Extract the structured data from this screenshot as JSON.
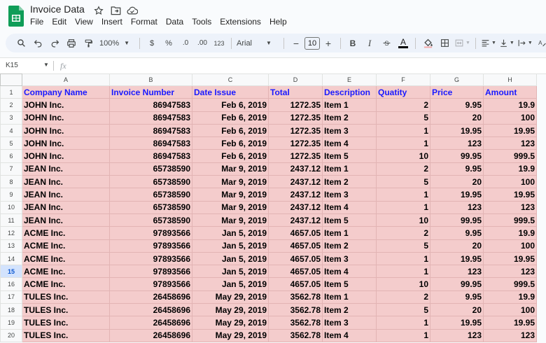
{
  "app": {
    "title": "Invoice Data",
    "menu": [
      "File",
      "Edit",
      "View",
      "Insert",
      "Format",
      "Data",
      "Tools",
      "Extensions",
      "Help"
    ],
    "icons": [
      "star-icon",
      "move-folder-icon",
      "cloud-status-icon"
    ]
  },
  "toolbar": {
    "zoom": "100%",
    "currency": "$",
    "percent": "%",
    "decrease_decimal": ".0",
    "increase_decimal": ".00",
    "number_format": "123",
    "font": "Arial",
    "font_size": "10",
    "bold": "B",
    "italic": "I",
    "text_color_label": "A",
    "text_color": "#000000",
    "fill_color": "#f4cccc"
  },
  "formula_bar": {
    "cell_ref": "K15",
    "fx": "fx",
    "value": ""
  },
  "sheet": {
    "columns": [
      "A",
      "B",
      "C",
      "D",
      "E",
      "F",
      "G",
      "H"
    ],
    "active_row": 15,
    "header": [
      "Company Name",
      "Invoice Number",
      "Date Issue",
      "Total",
      "Description",
      "Quatity",
      "Price",
      "Amount"
    ],
    "rows": [
      [
        "JOHN Inc.",
        "86947583",
        "Feb 6, 2019",
        "1272.35",
        "Item 1",
        "2",
        "9.95",
        "19.9"
      ],
      [
        "JOHN Inc.",
        "86947583",
        "Feb 6, 2019",
        "1272.35",
        "Item 2",
        "5",
        "20",
        "100"
      ],
      [
        "JOHN Inc.",
        "86947583",
        "Feb 6, 2019",
        "1272.35",
        "Item 3",
        "1",
        "19.95",
        "19.95"
      ],
      [
        "JOHN Inc.",
        "86947583",
        "Feb 6, 2019",
        "1272.35",
        "Item 4",
        "1",
        "123",
        "123"
      ],
      [
        "JOHN Inc.",
        "86947583",
        "Feb 6, 2019",
        "1272.35",
        "Item 5",
        "10",
        "99.95",
        "999.5"
      ],
      [
        "JEAN Inc.",
        "65738590",
        "Mar 9, 2019",
        "2437.12",
        "Item 1",
        "2",
        "9.95",
        "19.9"
      ],
      [
        "JEAN Inc.",
        "65738590",
        "Mar 9, 2019",
        "2437.12",
        "Item 2",
        "5",
        "20",
        "100"
      ],
      [
        "JEAN Inc.",
        "65738590",
        "Mar 9, 2019",
        "2437.12",
        "Item 3",
        "1",
        "19.95",
        "19.95"
      ],
      [
        "JEAN Inc.",
        "65738590",
        "Mar 9, 2019",
        "2437.12",
        "Item 4",
        "1",
        "123",
        "123"
      ],
      [
        "JEAN Inc.",
        "65738590",
        "Mar 9, 2019",
        "2437.12",
        "Item 5",
        "10",
        "99.95",
        "999.5"
      ],
      [
        "ACME Inc.",
        "97893566",
        "Jan 5, 2019",
        "4657.05",
        "Item 1",
        "2",
        "9.95",
        "19.9"
      ],
      [
        "ACME Inc.",
        "97893566",
        "Jan 5, 2019",
        "4657.05",
        "Item 2",
        "5",
        "20",
        "100"
      ],
      [
        "ACME Inc.",
        "97893566",
        "Jan 5, 2019",
        "4657.05",
        "Item 3",
        "1",
        "19.95",
        "19.95"
      ],
      [
        "ACME Inc.",
        "97893566",
        "Jan 5, 2019",
        "4657.05",
        "Item 4",
        "1",
        "123",
        "123"
      ],
      [
        "ACME Inc.",
        "97893566",
        "Jan 5, 2019",
        "4657.05",
        "Item 5",
        "10",
        "99.95",
        "999.5"
      ],
      [
        "TULES Inc.",
        "26458696",
        "May 29, 2019",
        "3562.78",
        "Item 1",
        "2",
        "9.95",
        "19.9"
      ],
      [
        "TULES Inc.",
        "26458696",
        "May 29, 2019",
        "3562.78",
        "Item 2",
        "5",
        "20",
        "100"
      ],
      [
        "TULES Inc.",
        "26458696",
        "May 29, 2019",
        "3562.78",
        "Item 3",
        "1",
        "19.95",
        "19.95"
      ],
      [
        "TULES Inc.",
        "26458696",
        "May 29, 2019",
        "3562.78",
        "Item 4",
        "1",
        "123",
        "123"
      ]
    ],
    "numeric_columns": [
      1,
      2,
      3,
      5,
      6,
      7
    ],
    "fill_color": "#f4cccc",
    "header_text_color": "#1a1aff"
  }
}
